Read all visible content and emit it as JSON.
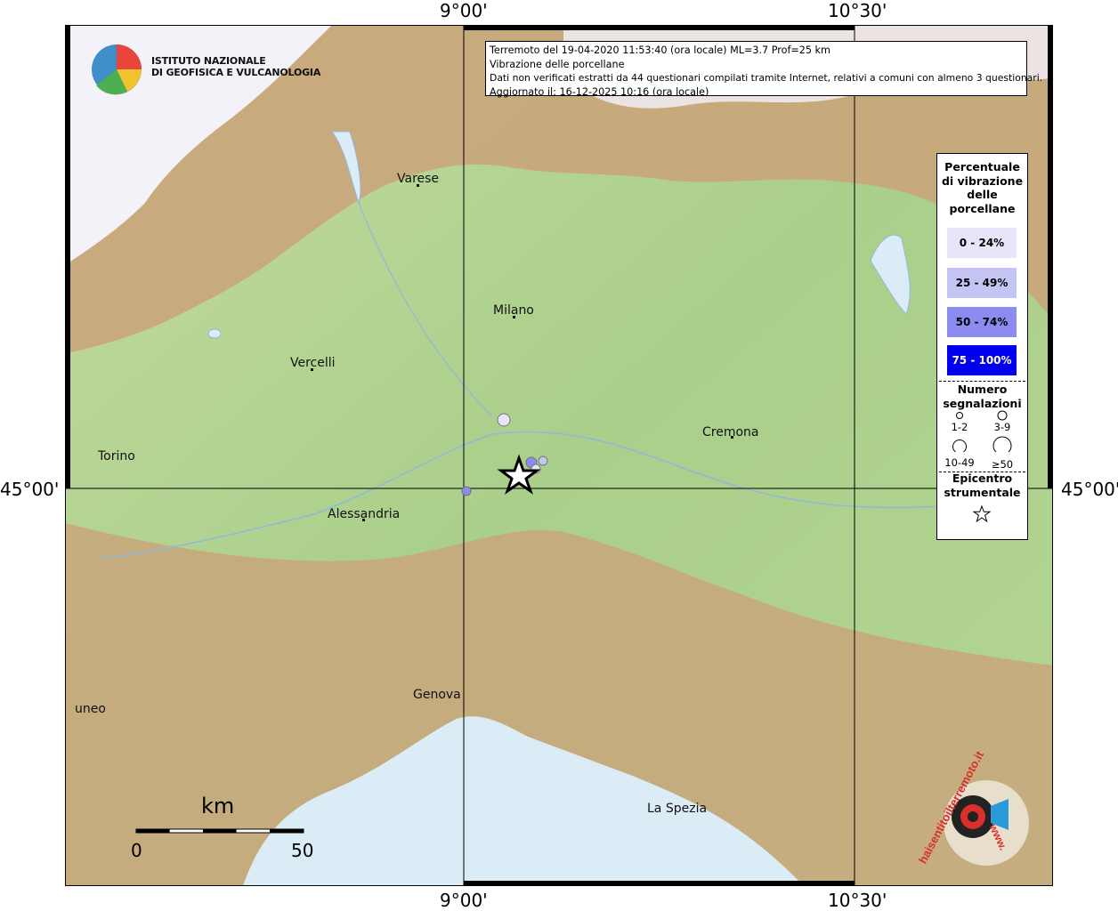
{
  "title_box": {
    "line1": "Terremoto del 19-04-2020 11:53:40 (ora locale) ML=3.7 Prof=25 km",
    "line2": "Vibrazione delle porcellane",
    "line3": "Dati non verificati estratti da 44 questionari compilati tramite Internet, relativi a comuni con almeno 3 questionari.",
    "line4": "Aggiornato il: 16-12-2025 10:16 (ora locale)"
  },
  "axes": {
    "top_left": "9°00'",
    "top_right": "10°30'",
    "bottom_left": "9°00'",
    "bottom_right": "10°30'",
    "left": "45°00'",
    "right": "45°00'"
  },
  "logo": {
    "line1": "ISTITUTO NAZIONALE",
    "line2": "DI GEOFISICA E VULCANOLOGIA"
  },
  "cities": [
    {
      "name": "Varese"
    },
    {
      "name": "Milano"
    },
    {
      "name": "Vercelli"
    },
    {
      "name": "Cremona"
    },
    {
      "name": "Torino"
    },
    {
      "name": "Alessandria"
    },
    {
      "name": "Genova"
    },
    {
      "name": "uneo"
    },
    {
      "name": "La Spezia"
    }
  ],
  "legend": {
    "title": [
      "Percentuale",
      "di vibrazione",
      "delle",
      "porcellane"
    ],
    "classes": [
      {
        "label": "0 - 24%",
        "color": "#e6e6f8"
      },
      {
        "label": "25 - 49%",
        "color": "#c4c4f5"
      },
      {
        "label": "50 - 74%",
        "color": "#8c8cf0"
      },
      {
        "label": "75 - 100%",
        "color": "#0000ee"
      }
    ],
    "count_title": [
      "Numero",
      "segnalazioni"
    ],
    "counts": [
      "1-2",
      "3-9",
      "10-49",
      "≥50"
    ],
    "epicenter_title": [
      "Epicentro",
      "strumentale"
    ]
  },
  "scale": {
    "unit": "km",
    "min": "0",
    "max": "50"
  },
  "brand": {
    "text": "haisentitoilterremoto.it",
    "prefix": "www."
  },
  "colors": {
    "sea": "#dcecf6",
    "plain": "#b9d68f",
    "mountain": "#c9a276",
    "snow": "#f3f2f8",
    "river": "#8fb8dc"
  }
}
